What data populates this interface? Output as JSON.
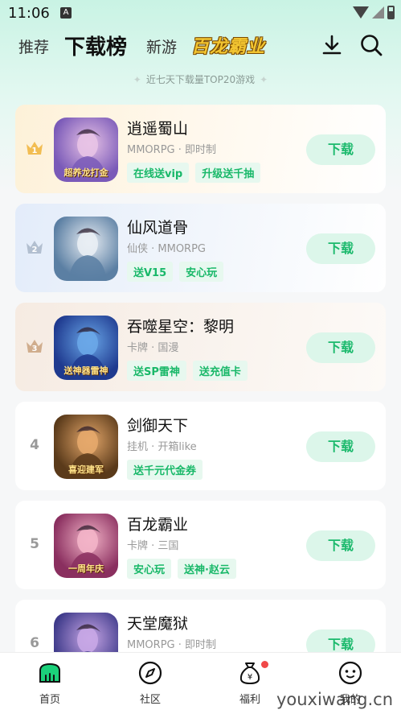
{
  "status_bar": {
    "time": "11:06",
    "notif": "A"
  },
  "header": {
    "tabs": [
      {
        "label": "推荐"
      },
      {
        "label": "下载榜"
      },
      {
        "label": "新游"
      }
    ],
    "brand": "百龙霸业"
  },
  "subtitle": "近七天下载量TOP20游戏",
  "games": [
    {
      "rank": "1",
      "name": "逍遥蜀山",
      "meta": "MMORPG · 即时制",
      "tags": [
        "在线送vip",
        "升级送千抽"
      ],
      "button": "下载",
      "icon_text": "超养龙打金",
      "colors": [
        "#7a5ab8",
        "#e8c3e6"
      ]
    },
    {
      "rank": "2",
      "name": "仙风道骨",
      "meta": "仙侠 · MMORPG",
      "tags": [
        "送V15",
        "安心玩"
      ],
      "button": "下载",
      "icon_text": "",
      "colors": [
        "#5b7fa3",
        "#e9eef4"
      ]
    },
    {
      "rank": "3",
      "name": "吞噬星空：黎明",
      "meta": "卡牌 · 国漫",
      "tags": [
        "送SP雷神",
        "送充值卡"
      ],
      "button": "下载",
      "icon_text": "送神器雷神",
      "colors": [
        "#1f3a8f",
        "#6aa7e8"
      ]
    },
    {
      "rank": "4",
      "name": "剑御天下",
      "meta": "挂机 · 开箱like",
      "tags": [
        "送千元代金券"
      ],
      "button": "下载",
      "icon_text": "喜迎建军",
      "colors": [
        "#5a3a1a",
        "#e5a86b"
      ]
    },
    {
      "rank": "5",
      "name": "百龙霸业",
      "meta": "卡牌 · 三国",
      "tags": [
        "安心玩",
        "送神·赵云"
      ],
      "button": "下载",
      "icon_text": "一周年庆",
      "colors": [
        "#8a2f5f",
        "#f3b4c8"
      ]
    },
    {
      "rank": "6",
      "name": "天堂魔狱",
      "meta": "MMORPG · 即时制",
      "tags": [],
      "button": "下载",
      "icon_text": "",
      "colors": [
        "#3e3a8a",
        "#c8a7e6"
      ]
    }
  ],
  "bottom_nav": [
    {
      "label": "首页",
      "icon": "home-icon"
    },
    {
      "label": "社区",
      "icon": "compass-icon"
    },
    {
      "label": "福利",
      "icon": "money-bag-icon"
    },
    {
      "label": "我的",
      "icon": "profile-face-icon"
    }
  ],
  "watermark": "youxiwang.cn",
  "colors": {
    "accent": "#1bb96c",
    "button_bg": "#dcf6ea",
    "tag_bg": "#e7f8ef"
  }
}
